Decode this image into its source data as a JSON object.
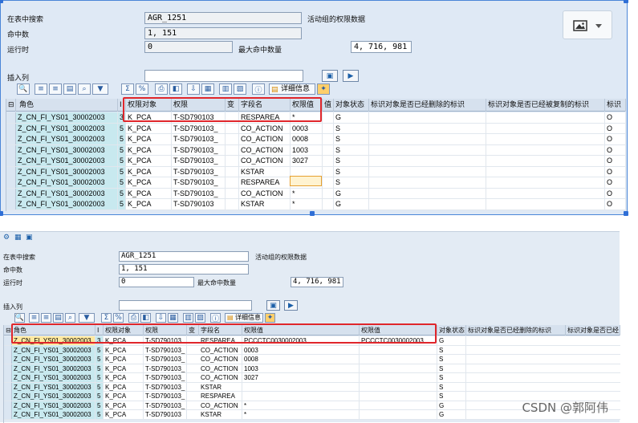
{
  "top": {
    "search_label": "在表中搜索",
    "search_value": "AGR_1251",
    "search_desc": "活动组的权限数据",
    "hits_label": "命中数",
    "hits_value": "1, 151",
    "runtime_label": "运行时",
    "runtime_value": "0",
    "max_hits_label": "最大命中数量",
    "max_hits_value": "4, 716, 981",
    "insert_col_label": "插入列",
    "insert_col_value": "",
    "detail_btn": "详细信息",
    "columns": [
      "角色",
      "I",
      "权限对象",
      "权限",
      "变",
      "字段名",
      "权限值",
      "值",
      "对象状态",
      "标识对象是否已经删除的标识",
      "标识对象是否已经被复制的标识",
      "标识"
    ],
    "rows": [
      {
        "role": "Z_CN_FI_YS01_30002003",
        "i": "3",
        "obj": "K_PCA",
        "auth": "T-SD790103",
        "var": "",
        "field": "RESPAREA",
        "val": "*",
        "v2": "",
        "status": "G",
        "del": "",
        "copy": "",
        "mark": "O"
      },
      {
        "role": "Z_CN_FI_YS01_30002003",
        "i": "5",
        "obj": "K_PCA",
        "auth": "T-SD790103_",
        "var": "",
        "field": "CO_ACTION",
        "val": "0003",
        "v2": "",
        "status": "S",
        "del": "",
        "copy": "",
        "mark": "O"
      },
      {
        "role": "Z_CN_FI_YS01_30002003",
        "i": "5",
        "obj": "K_PCA",
        "auth": "T-SD790103_",
        "var": "",
        "field": "CO_ACTION",
        "val": "0008",
        "v2": "",
        "status": "S",
        "del": "",
        "copy": "",
        "mark": "O"
      },
      {
        "role": "Z_CN_FI_YS01_30002003",
        "i": "5",
        "obj": "K_PCA",
        "auth": "T-SD790103_",
        "var": "",
        "field": "CO_ACTION",
        "val": "1003",
        "v2": "",
        "status": "S",
        "del": "",
        "copy": "",
        "mark": "O"
      },
      {
        "role": "Z_CN_FI_YS01_30002003",
        "i": "5",
        "obj": "K_PCA",
        "auth": "T-SD790103_",
        "var": "",
        "field": "CO_ACTION",
        "val": "3027",
        "v2": "",
        "status": "S",
        "del": "",
        "copy": "",
        "mark": "O"
      },
      {
        "role": "Z_CN_FI_YS01_30002003",
        "i": "5",
        "obj": "K_PCA",
        "auth": "T-SD790103_",
        "var": "",
        "field": "KSTAR",
        "val": "",
        "v2": "",
        "status": "S",
        "del": "",
        "copy": "",
        "mark": "O"
      },
      {
        "role": "Z_CN_FI_YS01_30002003",
        "i": "5",
        "obj": "K_PCA",
        "auth": "T-SD790103_",
        "var": "",
        "field": "RESPAREA",
        "val": "",
        "v2": "",
        "status": "S",
        "del": "",
        "copy": "",
        "mark": "O"
      },
      {
        "role": "Z_CN_FI_YS01_30002003",
        "i": "5",
        "obj": "K_PCA",
        "auth": "T-SD790103_",
        "var": "",
        "field": "CO_ACTION",
        "val": "*",
        "v2": "",
        "status": "G",
        "del": "",
        "copy": "",
        "mark": "O"
      },
      {
        "role": "Z_CN_FI_YS01_30002003",
        "i": "5",
        "obj": "K_PCA",
        "auth": "T-SD790103",
        "var": "",
        "field": "KSTAR",
        "val": "*",
        "v2": "",
        "status": "G",
        "del": "",
        "copy": "",
        "mark": "O"
      }
    ]
  },
  "bottom": {
    "search_label": "在表中搜索",
    "search_value": "AGR_1251",
    "search_desc": "活动组的权限数据",
    "hits_label": "命中数",
    "hits_value": "1, 151",
    "runtime_label": "运行时",
    "runtime_value": "0",
    "max_hits_label": "最大命中数量",
    "max_hits_value": "4, 716, 981",
    "insert_col_label": "插入列",
    "detail_btn": "详细信息",
    "columns": [
      "角色",
      "I",
      "权限对象",
      "权限",
      "变",
      "字段名",
      "权限值",
      "权限值",
      "对象状态",
      "标识对象是否已经删除的标识",
      "标识对象是否已经"
    ],
    "rows": [
      {
        "role": "Z_CN_FI_YS01_30002003",
        "i": "3",
        "obj": "K_PCA",
        "auth": "T-SD790103",
        "field": "RESPAREA",
        "val": "PCCCTC0030002003",
        "val2": "PCCCTC0030002003",
        "status": "G"
      },
      {
        "role": "Z_CN_FI_YS01_30002003",
        "i": "5",
        "obj": "K_PCA",
        "auth": "T-SD790103_",
        "field": "CO_ACTION",
        "val": "0003",
        "val2": "",
        "status": "S"
      },
      {
        "role": "Z_CN_FI_YS01_30002003",
        "i": "5",
        "obj": "K_PCA",
        "auth": "T-SD790103_",
        "field": "CO_ACTION",
        "val": "0008",
        "val2": "",
        "status": "S"
      },
      {
        "role": "Z_CN_FI_YS01_30002003",
        "i": "5",
        "obj": "K_PCA",
        "auth": "T-SD790103_",
        "field": "CO_ACTION",
        "val": "1003",
        "val2": "",
        "status": "S"
      },
      {
        "role": "Z_CN_FI_YS01_30002003",
        "i": "5",
        "obj": "K_PCA",
        "auth": "T-SD790103_",
        "field": "CO_ACTION",
        "val": "3027",
        "val2": "",
        "status": "S"
      },
      {
        "role": "Z_CN_FI_YS01_30002003",
        "i": "5",
        "obj": "K_PCA",
        "auth": "T-SD790103_",
        "field": "KSTAR",
        "val": "",
        "val2": "",
        "status": "S"
      },
      {
        "role": "Z_CN_FI_YS01_30002003",
        "i": "5",
        "obj": "K_PCA",
        "auth": "T-SD790103_",
        "field": "RESPAREA",
        "val": "",
        "val2": "",
        "status": "S"
      },
      {
        "role": "Z_CN_FI_YS01_30002003",
        "i": "5",
        "obj": "K_PCA",
        "auth": "T-SD790103_",
        "field": "CO_ACTION",
        "val": "*",
        "val2": "",
        "status": "G"
      },
      {
        "role": "Z_CN_FI_YS01_30002003",
        "i": "5",
        "obj": "K_PCA",
        "auth": "T-SD790103",
        "field": "KSTAR",
        "val": "*",
        "val2": "",
        "status": "G"
      }
    ]
  },
  "watermark": "CSDN @郭阿伟",
  "colors": {
    "accent": "#4a86d8",
    "highlight": "#e0262b",
    "role_cell": "#c8e9ef",
    "selected_row": "#ffe9a0"
  },
  "icons": [
    "image-placeholder-icon",
    "dropdown-caret-icon",
    "toolbar-icons",
    "detail-info-icon",
    "execute-icon"
  ]
}
